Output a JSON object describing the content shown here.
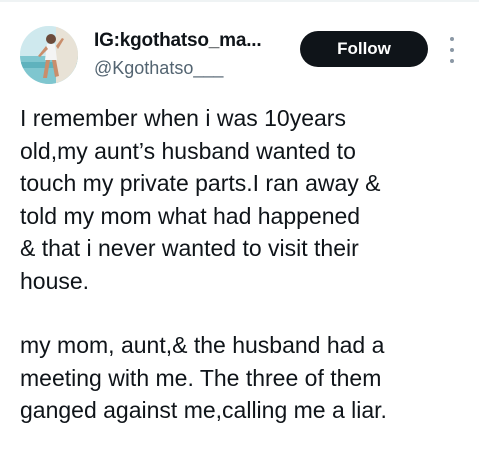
{
  "profile": {
    "display_name": "IG:kgothatso_ma...",
    "handle": "@Kgothatso___",
    "avatar_icon": "profile-photo"
  },
  "actions": {
    "follow_label": "Follow",
    "more_icon": "more-vertical-icon"
  },
  "tweet": {
    "paragraphs": [
      "I remember when i was 10years\nold,my aunt’s husband wanted to\ntouch my private parts.I ran away &\ntold my mom what had happened\n& that i never wanted to visit their\nhouse.",
      "my mom, aunt,& the husband had a\nmeeting with me. The three of them\nganged against me,calling me a liar."
    ]
  },
  "colors": {
    "text_primary": "#0f1419",
    "text_secondary": "#536471",
    "follow_bg": "#0f1419",
    "follow_text": "#ffffff"
  }
}
